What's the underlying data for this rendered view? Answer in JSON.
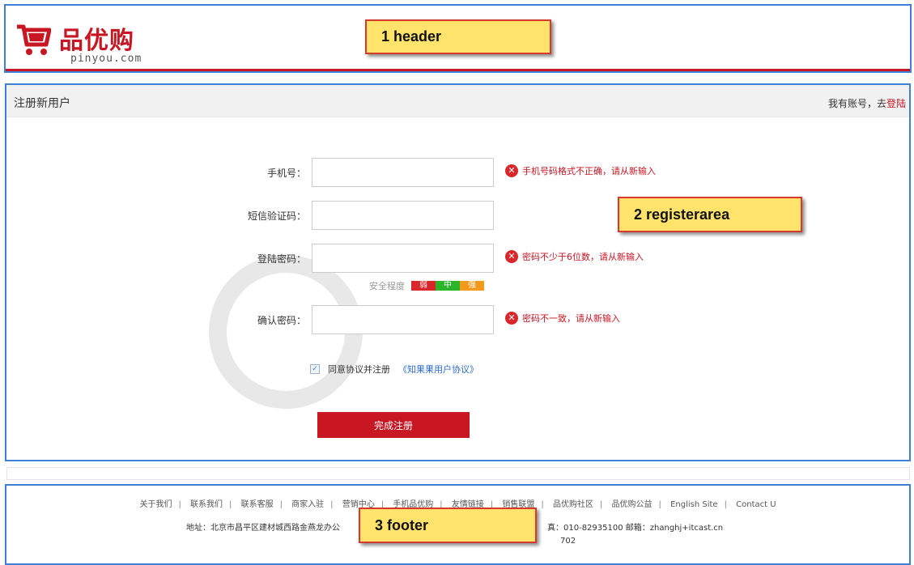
{
  "header": {
    "logo_title": "品优购",
    "logo_subtitle": "pinyou.com",
    "callout": "1  header"
  },
  "register": {
    "title": "注册新用户",
    "login_hint": "我有账号，去",
    "login_link": "登陆",
    "callout": "2  registerarea",
    "fields": [
      {
        "label": "手机号：",
        "value": "",
        "error": "手机号码格式不正确，请从新输入"
      },
      {
        "label": "短信验证码：",
        "value": "",
        "error": ""
      },
      {
        "label": "登陆密码：",
        "value": "",
        "error": "密码不少于6位数，请从新输入"
      },
      {
        "label": "确认密码：",
        "value": "",
        "error": "密码不一致，请从新输入"
      }
    ],
    "strength": {
      "label": "安全程度",
      "weak": "弱",
      "mid": "中",
      "strong": "强"
    },
    "agree_text": "同意协议并注册",
    "agree_link": "《知果果用户协议》",
    "agree_checked": true,
    "submit": "完成注册"
  },
  "footer": {
    "links": [
      "关于我们",
      "联系我们",
      "联系客服",
      "商家入驻",
      "营销中心",
      "手机品优购",
      "友情链接",
      "销售联盟",
      "品优购社区",
      "品优购公益",
      "English Site",
      "Contact U"
    ],
    "address": "地址：北京市昌平区建材城西路金燕龙办公",
    "contact": "真：010-82935100 邮箱：zhanghj+itcast.cn",
    "icp": "702",
    "callout": "3 footer"
  }
}
